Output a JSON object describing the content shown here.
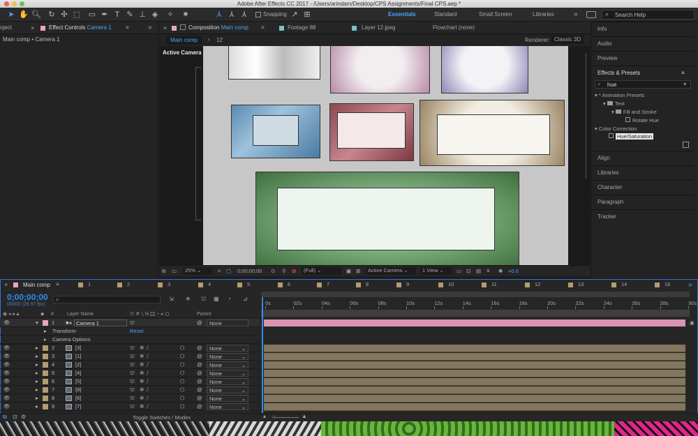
{
  "window": {
    "title": "Adobe After Effects CC 2017 - /Users/arindam/Desktop/CPS Assignments/Final CPS.aep *"
  },
  "toolbar": {
    "snapping": "Snapping",
    "workspaces": [
      "Essentials",
      "Standard",
      "Small Screen",
      "Libraries"
    ],
    "search_placeholder": "Search Help"
  },
  "left_panel": {
    "project_tab": "oject",
    "effect_controls_tab": "Effect Controls",
    "effect_controls_target": "Camera 1",
    "breadcrumb": "Main comp • Camera 1"
  },
  "comp_tabs": {
    "composition_label": "Composition",
    "composition_name": "Main comp",
    "footage": "Footage 88",
    "layer": "Layer 12.jpeg",
    "flowchart": "Flowchart (none)"
  },
  "comp_subbar": {
    "active": "Main comp",
    "other": "12",
    "renderer_label": "Renderer:",
    "renderer": "Classic 3D",
    "view_label": "Active Camera"
  },
  "viewer_bar": {
    "zoom": "25%",
    "timecode": "0;00;00;00",
    "resolution": "(Full)",
    "camera": "Active Camera",
    "views": "1 View",
    "exposure": "+0.0"
  },
  "right_panel": {
    "items": [
      "Info",
      "Audio",
      "Preview"
    ],
    "effects_title": "Effects & Presets",
    "search": "hue",
    "tree": {
      "animation_presets": "* Animation Presets",
      "text": "Text",
      "fill_stroke": "Fill and Stroke",
      "rotate_hue": "Rotate Hue",
      "color_correction": "Color Correction",
      "hue_saturation": "Hue/Saturation"
    },
    "lower": [
      "Align",
      "Libraries",
      "Character",
      "Paragraph",
      "Tracker"
    ]
  },
  "timeline": {
    "active_tab": "Main comp",
    "timecode": "0;00;00;00",
    "fps": "00000 (29.97 fps)",
    "comp_tabs": [
      "1",
      "2",
      "3",
      "4",
      "5",
      "6",
      "7",
      "8",
      "9",
      "10",
      "11",
      "12",
      "13",
      "14",
      "16"
    ],
    "headers": {
      "num": "#",
      "layer_name": "Layer Name",
      "parent": "Parent"
    },
    "camera": {
      "index": "1",
      "name": "Camera 1",
      "parent": "None"
    },
    "sub": {
      "transform": "Transform",
      "reset": "Reset",
      "camera_options": "Camera Options"
    },
    "layers": [
      {
        "index": "2",
        "name": "[3]",
        "parent": "None"
      },
      {
        "index": "3",
        "name": "[1]",
        "parent": "None"
      },
      {
        "index": "4",
        "name": "[2]",
        "parent": "None"
      },
      {
        "index": "5",
        "name": "[4]",
        "parent": "None"
      },
      {
        "index": "6",
        "name": "[5]",
        "parent": "None"
      },
      {
        "index": "7",
        "name": "[8]",
        "parent": "None"
      },
      {
        "index": "8",
        "name": "[6]",
        "parent": "None"
      },
      {
        "index": "9",
        "name": "[7]",
        "parent": "None"
      }
    ],
    "ruler": [
      "0s",
      "02s",
      "04s",
      "06s",
      "08s",
      "10s",
      "12s",
      "14s",
      "16s",
      "18s",
      "20s",
      "22s",
      "24s",
      "26s",
      "28s",
      "30s"
    ],
    "toggle_label": "Toggle Switches / Modes"
  },
  "colors": {
    "accent": "#2d8ceb",
    "camera_bar": "#d992b0",
    "layer_bar": "#82765e",
    "label_pink": "#e8a6bf",
    "label_tan": "#b59b72"
  }
}
